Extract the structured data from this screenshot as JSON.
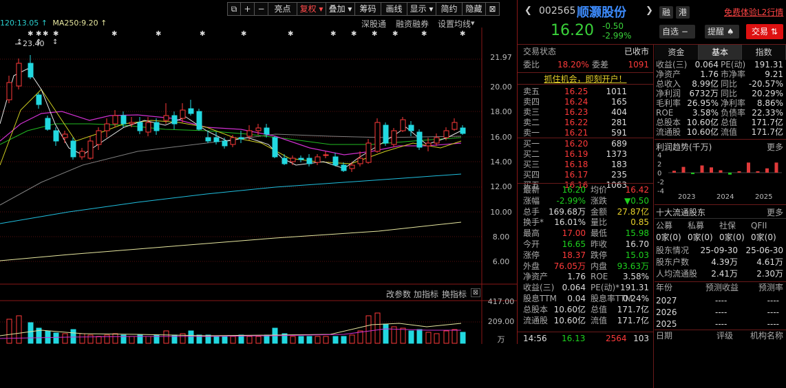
{
  "toolbar": {
    "items": [
      "⧉",
      "+",
      "−",
      "亮点",
      "复权",
      "叠加",
      "筹码",
      "画线",
      "显示",
      "简约",
      "隐藏",
      "⊠"
    ]
  },
  "ma": {
    "ma_a": "120:13.05",
    "ma250": "MA250:9.20",
    "arrow": "↑"
  },
  "sub_links": [
    "深股通",
    "融资融券",
    "设置均线"
  ],
  "price_axis": [
    "21.97",
    "20.00",
    "18.00",
    "16.00",
    "14.00",
    "12.00",
    "10.00",
    "8.00",
    "6.00"
  ],
  "high_mark": "23.40",
  "ind_bar": [
    "改参数",
    "加指标",
    "换指标",
    "⊠"
  ],
  "vol_axis": [
    "417.00",
    "209.00",
    "万"
  ],
  "header": {
    "code": "002565",
    "name": "顺灏股份",
    "btn_rong": "融",
    "btn_gang": "港",
    "l2": "免费体验L2行情",
    "price": "16.20",
    "change": "-0.50",
    "pct": "-2.99%",
    "zixuan": "自选",
    "remind": "提醒",
    "trade": "交易"
  },
  "status": {
    "label": "交易状态",
    "value": "已收市"
  },
  "weibi": {
    "l1": "委比",
    "v1": "18.20%",
    "l2": "委差",
    "v2": "1091"
  },
  "promo": "抓住机会，即刻开户！",
  "asks": [
    {
      "l": "卖五",
      "p": "16.25",
      "v": "1011"
    },
    {
      "l": "卖四",
      "p": "16.24",
      "v": "165"
    },
    {
      "l": "卖三",
      "p": "16.23",
      "v": "404"
    },
    {
      "l": "卖二",
      "p": "16.22",
      "v": "281"
    },
    {
      "l": "卖一",
      "p": "16.21",
      "v": "591"
    }
  ],
  "bids": [
    {
      "l": "买一",
      "p": "16.20",
      "v": "689"
    },
    {
      "l": "买二",
      "p": "16.19",
      "v": "1373"
    },
    {
      "l": "买三",
      "p": "16.18",
      "v": "183"
    },
    {
      "l": "买四",
      "p": "16.17",
      "v": "235"
    },
    {
      "l": "买五",
      "p": "16.16",
      "v": "1063"
    }
  ],
  "quote": [
    {
      "l1": "最新",
      "v1": "16.20",
      "c1": "green",
      "l2": "均价",
      "v2": "16.42",
      "c2": "red"
    },
    {
      "l1": "涨幅",
      "v1": "-2.99%",
      "c1": "green",
      "l2": "涨跌",
      "v2": "▼0.50",
      "c2": "green"
    },
    {
      "l1": "总手",
      "v1": "169.68万",
      "c1": "white",
      "l2": "金额",
      "v2": "27.87亿",
      "c2": "yellow"
    },
    {
      "l1": "换手*",
      "v1": "16.01%",
      "c1": "white",
      "l2": "量比",
      "v2": "0.85",
      "c2": "yellow"
    },
    {
      "l1": "最高",
      "v1": "17.00",
      "c1": "red",
      "l2": "最低",
      "v2": "15.98",
      "c2": "green"
    },
    {
      "l1": "今开",
      "v1": "16.65",
      "c1": "green",
      "l2": "昨收",
      "v2": "16.70",
      "c2": "white"
    },
    {
      "l1": "涨停",
      "v1": "18.37",
      "c1": "red",
      "l2": "跌停",
      "v2": "15.03",
      "c2": "green"
    },
    {
      "l1": "外盘",
      "v1": "76.05万",
      "c1": "red",
      "l2": "内盘",
      "v2": "93.63万",
      "c2": "green"
    },
    {
      "l1": "净资产",
      "v1": "1.76",
      "c1": "white",
      "l2": "ROE",
      "v2": "3.58%",
      "c2": "white"
    },
    {
      "l1": "收益(三)",
      "v1": "0.064",
      "c1": "white",
      "l2": "PE(动)*",
      "v2": "191.31",
      "c2": "white"
    },
    {
      "l1": "股息TTM",
      "v1": "0.04",
      "c1": "white",
      "l2": "股息率TTM",
      "v2": "0.24%",
      "c2": "white"
    },
    {
      "l1": "总股本",
      "v1": "10.60亿",
      "c1": "white",
      "l2": "总值",
      "v2": "171.7亿",
      "c2": "white"
    },
    {
      "l1": "流通股",
      "v1": "10.60亿",
      "c1": "white",
      "l2": "流值",
      "v2": "171.7亿",
      "c2": "white"
    }
  ],
  "tick": {
    "time": "14:56",
    "price": "16.13",
    "vol": "2564",
    "num": "103"
  },
  "fin_tabs": [
    "资金",
    "基本",
    "指数"
  ],
  "fin": [
    {
      "l1": "收益(三)",
      "v1": "0.064",
      "l2": "PE(动)",
      "v2": "191.31"
    },
    {
      "l1": "净资产",
      "v1": "1.76",
      "l2": "市净率",
      "v2": "9.21"
    },
    {
      "l1": "总收入",
      "v1": "8.99亿",
      "l2": "同比",
      "v2": "-20.57%"
    },
    {
      "l1": "净利润",
      "v1": "6732万",
      "l2": "同比",
      "v2": "20.29%"
    },
    {
      "l1": "毛利率",
      "v1": "26.95%",
      "l2": "净利率",
      "v2": "8.86%"
    },
    {
      "l1": "ROE",
      "v1": "3.58%",
      "l2": "负债率",
      "v2": "22.33%"
    },
    {
      "l1": "总股本",
      "v1": "10.60亿",
      "l2": "总值",
      "v2": "171.7亿"
    },
    {
      "l1": "流通股",
      "v1": "10.60亿",
      "l2": "流值",
      "v2": "171.7亿"
    }
  ],
  "profit": {
    "title": "利润趋势(千万)",
    "more": "更多",
    "yticks": [
      "4",
      "2",
      "0",
      "-2",
      "-4"
    ],
    "years": [
      "2023",
      "2024",
      "2025"
    ],
    "bars": [
      0.4,
      1.2,
      -0.3,
      1.5,
      1.1,
      0.5,
      -0.4,
      0.3,
      2.1,
      0.3,
      0.9,
      2.1
    ]
  },
  "holders": {
    "title": "十大流通股东",
    "more": "更多",
    "cats": [
      "公募",
      "私募",
      "社保",
      "QFII"
    ],
    "vals": [
      "0家(0)",
      "0家(0)",
      "0家(0)",
      "0家(0)"
    ],
    "rows": [
      {
        "l": "股东情况",
        "a": "25-09-30",
        "b": "25-06-30"
      },
      {
        "l": "股东户数",
        "a": "4.39万",
        "b": "4.61万"
      },
      {
        "l": "人均流通股",
        "a": "2.41万",
        "b": "2.30万"
      }
    ]
  },
  "forecast": {
    "cols": [
      "年份",
      "预测收益",
      "预测率"
    ],
    "rows": [
      {
        "y": "2027",
        "a": "----",
        "b": "----"
      },
      {
        "y": "2026",
        "a": "----",
        "b": "----"
      },
      {
        "y": "2025",
        "a": "----",
        "b": "----"
      }
    ]
  },
  "rating": {
    "cols": [
      "日期",
      "评级",
      "机构名称"
    ]
  }
}
